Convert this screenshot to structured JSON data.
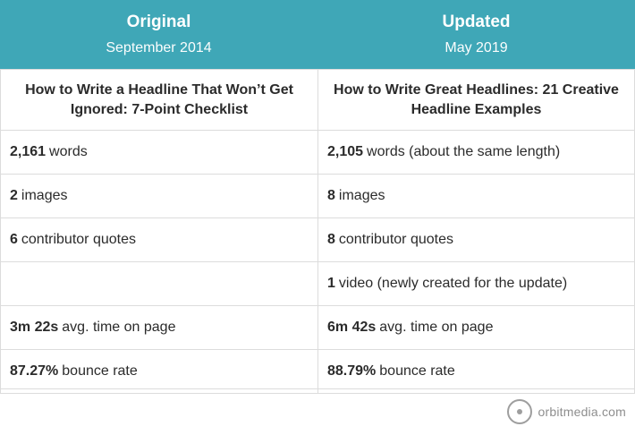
{
  "header": {
    "left_title": "Original",
    "left_date": "September 2014",
    "right_title": "Updated",
    "right_date": "May 2019"
  },
  "headlines": {
    "left": "How to Write a Headline That Won’t Get Ignored: 7-Point Checklist",
    "right": "How to Write Great Headlines: 21 Creative Headline Examples"
  },
  "rows": [
    {
      "left_bold": "2,161",
      "left_text": "words",
      "right_bold": "2,105",
      "right_text": "words (about the same length)"
    },
    {
      "left_bold": "2",
      "left_text": "images",
      "right_bold": "8",
      "right_text": "images"
    },
    {
      "left_bold": "6",
      "left_text": "contributor quotes",
      "right_bold": "8",
      "right_text": "contributor quotes"
    },
    {
      "left_bold": "",
      "left_text": "",
      "right_bold": "1",
      "right_text": "video (newly created for the update)"
    },
    {
      "left_bold": "3m 22s",
      "left_text": "avg. time on page",
      "right_bold": "6m 42s",
      "right_text": "avg. time on page"
    },
    {
      "left_bold": "87.27%",
      "left_text": "bounce rate",
      "right_bold": "88.79%",
      "right_text": "bounce rate"
    }
  ],
  "logo": {
    "text": "orbitmedia.com"
  }
}
